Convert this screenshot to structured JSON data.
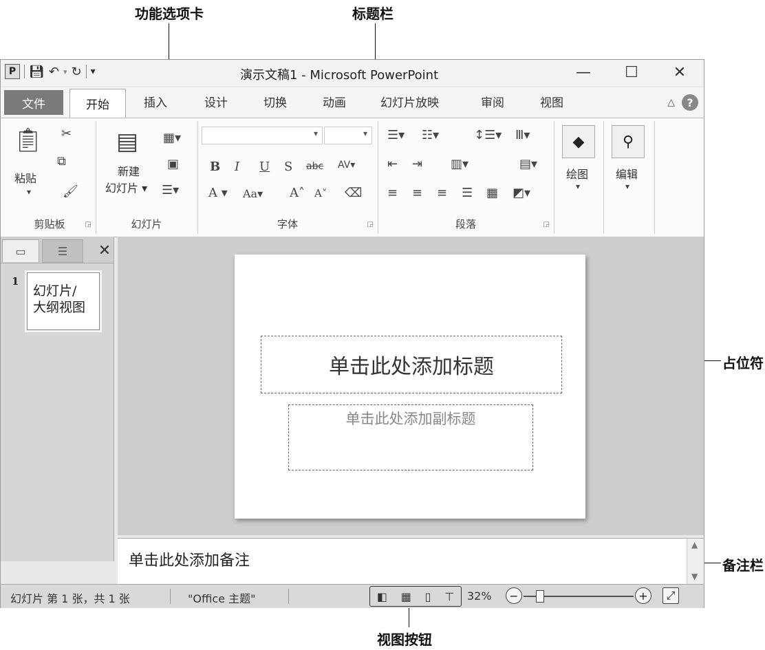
{
  "annotations": {
    "ribbon_tabs": "功能选项卡",
    "title_bar": "标题栏",
    "placeholder": "占位符",
    "notes_bar": "备注栏",
    "view_buttons": "视图按钮"
  },
  "window": {
    "logo": "P",
    "title": "演示文稿1  -  Microsoft PowerPoint",
    "minimize": "—",
    "maximize": "☐",
    "close": "✕"
  },
  "tabs": [
    "文件",
    "开始",
    "插入",
    "设计",
    "切换",
    "动画",
    "幻灯片放映",
    "审阅",
    "视图"
  ],
  "help": "?",
  "ribbon": {
    "clipboard": {
      "paste": "粘贴",
      "label": "剪贴板"
    },
    "slides": {
      "new_slide_line1": "新建",
      "new_slide_line2": "幻灯片 ▾",
      "label": "幻灯片"
    },
    "font": {
      "label": "字体"
    },
    "paragraph": {
      "label": "段落"
    },
    "drawing": {
      "label": "绘图"
    },
    "editing": {
      "label": "编辑"
    }
  },
  "left_pane": {
    "close": "✕",
    "slide_number": "1",
    "thumb_label": "幻灯片/\n大纲视图"
  },
  "slide": {
    "title_placeholder": "单击此处添加标题",
    "subtitle_placeholder": "单击此处添加副标题"
  },
  "notes": {
    "placeholder": "单击此处添加备注"
  },
  "status": {
    "slide_info": "幻灯片 第 1 张，共 1 张",
    "theme": "\"Office 主题\"",
    "zoom": "32%"
  }
}
